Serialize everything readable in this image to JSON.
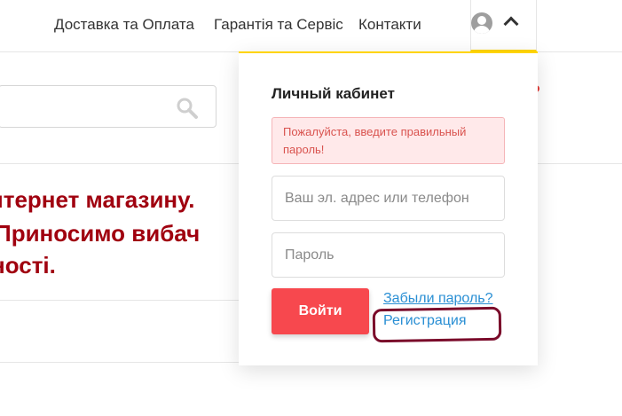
{
  "nav": {
    "delivery": "Доставка та Оплата",
    "warranty": "Гарантія та Сервіс",
    "contacts": "Контакти"
  },
  "promo": {
    "line1": "нтернет магазину.",
    "line2": "Приносимо вибач",
    "line3": "ності."
  },
  "login": {
    "title": "Личный кабинет",
    "error": "Пожалуйста, введите правильный пароль!",
    "email_placeholder": "Ваш эл. адрес или телефон",
    "password_placeholder": "Пароль",
    "submit_label": "Войти",
    "forgot_label": "Забыли пароль?",
    "register_label": "Регистрация"
  },
  "colors": {
    "accent": "#ffd400",
    "login_button": "#f7484e",
    "promo_text": "#a0000f",
    "link": "#2a8fd4",
    "error_bg": "#ffe9ea"
  },
  "icons": {
    "user": "user-avatar-icon",
    "toggle": "chevron-up-icon",
    "search": "search-icon"
  }
}
